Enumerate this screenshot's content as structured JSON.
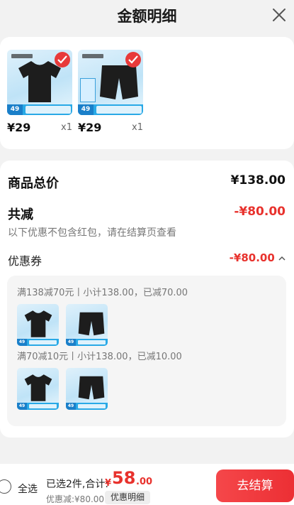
{
  "header": {
    "title": "金额明细",
    "close_icon": "close-icon"
  },
  "products": [
    {
      "badge_num": "49",
      "price": "¥29",
      "qty": "x1",
      "kind": "tshirt"
    },
    {
      "badge_num": "49",
      "price": "¥29",
      "qty": "x1",
      "kind": "shorts"
    }
  ],
  "summary": {
    "total_label": "商品总价",
    "total_value": "¥138.00",
    "discount_label": "共减",
    "discount_value": "-¥80.00",
    "discount_note": "以下优惠不包含红包，请在结算页查看",
    "coupon_label": "优惠券",
    "coupon_value": "-¥80.00",
    "rules": [
      {
        "text": "满138减70元丨小计138.00，已减70.00"
      },
      {
        "text": "满70减10元丨小计138.00，已减10.00"
      }
    ]
  },
  "footer": {
    "select_all": "全选",
    "selected_text": "已选2件,合计:",
    "currency": "¥",
    "total_int": "58",
    "total_dec": ".00",
    "discount_text": "优惠减:¥80.00",
    "detail_button": "优惠明细",
    "checkout_button": "去结算"
  },
  "colors": {
    "accent_red": "#e8322d",
    "checkout_red": "#ec2f34",
    "badge_blue": "#29a9e6"
  }
}
